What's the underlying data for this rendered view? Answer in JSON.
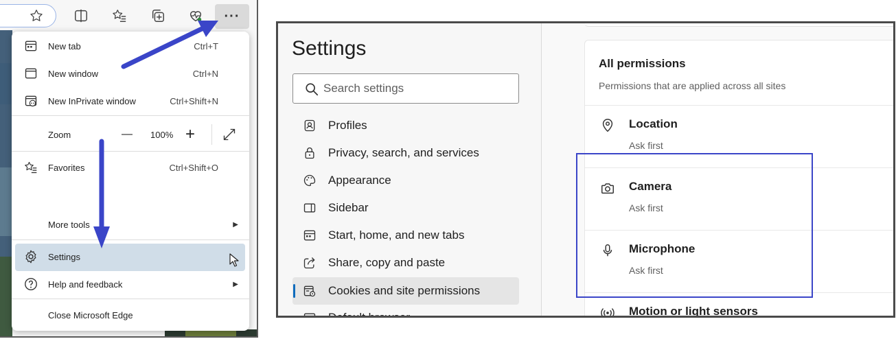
{
  "left_panel": {
    "menu": {
      "items": [
        {
          "label": "New tab",
          "shortcut": "Ctrl+T"
        },
        {
          "label": "New window",
          "shortcut": "Ctrl+N"
        },
        {
          "label": "New InPrivate window",
          "shortcut": "Ctrl+Shift+N"
        }
      ],
      "zoom": {
        "label": "Zoom",
        "minus": "—",
        "value": "100%",
        "plus": "+"
      },
      "favorites": {
        "label": "Favorites",
        "shortcut": "Ctrl+Shift+O"
      },
      "more_tools": {
        "label": "More tools"
      },
      "settings": {
        "label": "Settings"
      },
      "help": {
        "label": "Help and feedback"
      },
      "close": {
        "label": "Close Microsoft Edge"
      }
    },
    "more_button_label": "···",
    "annotation_color": "#3a45c8"
  },
  "settings": {
    "title": "Settings",
    "search_placeholder": "Search settings",
    "nav": [
      {
        "label": "Profiles",
        "icon": "profile-icon"
      },
      {
        "label": "Privacy, search, and services",
        "icon": "lock-icon"
      },
      {
        "label": "Appearance",
        "icon": "palette-icon"
      },
      {
        "label": "Sidebar",
        "icon": "sidebar-icon"
      },
      {
        "label": "Start, home, and new tabs",
        "icon": "home-tabs-icon"
      },
      {
        "label": "Share, copy and paste",
        "icon": "share-icon"
      },
      {
        "label": "Cookies and site permissions",
        "icon": "cookies-icon",
        "active": true
      },
      {
        "label": "Default browser",
        "icon": "browser-icon"
      }
    ],
    "permissions": {
      "title": "All permissions",
      "subtitle": "Permissions that are applied across all sites",
      "items": [
        {
          "name": "Location",
          "value": "Ask first",
          "icon": "location-icon"
        },
        {
          "name": "Camera",
          "value": "Ask first",
          "icon": "camera-icon"
        },
        {
          "name": "Microphone",
          "value": "Ask first",
          "icon": "microphone-icon"
        },
        {
          "name": "Motion or light sensors",
          "value": "",
          "icon": "sensors-icon"
        }
      ]
    }
  }
}
